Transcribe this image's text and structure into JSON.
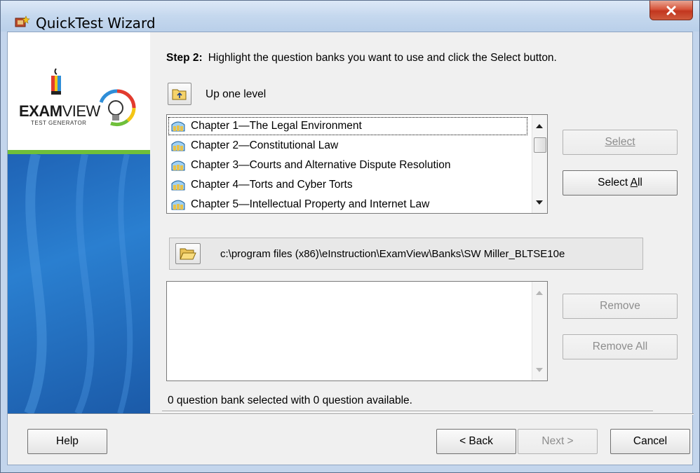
{
  "window": {
    "title": "QuickTest Wizard",
    "close_glyph": "✕"
  },
  "sidebar": {
    "logo_main": "EXAM",
    "logo_view": "VIEW",
    "logo_sub": "TEST GENERATOR"
  },
  "step": {
    "label": "Step 2:",
    "instruction": "Highlight the question banks you want to use and click the Select button."
  },
  "up_level": {
    "label": "Up one level"
  },
  "banks": {
    "items": [
      {
        "label": "Chapter 1—The Legal Environment",
        "selected": true
      },
      {
        "label": "Chapter 2—Constitutional Law",
        "selected": false
      },
      {
        "label": "Chapter 3—Courts and Alternative Dispute Resolution",
        "selected": false
      },
      {
        "label": "Chapter 4—Torts and Cyber Torts",
        "selected": false
      },
      {
        "label": "Chapter 5—Intellectual Property and Internet Law",
        "selected": false
      }
    ]
  },
  "buttons": {
    "select": "Select",
    "select_all_prefix": "Select ",
    "select_all_accel": "A",
    "select_all_suffix": "ll",
    "remove": "Remove",
    "remove_all": "Remove All",
    "help": "Help",
    "back": "< Back",
    "next": "Next >",
    "cancel": "Cancel"
  },
  "path": {
    "value": "c:\\program files (x86)\\eInstruction\\ExamView\\Banks\\SW Miller_BLTSE10e"
  },
  "status": {
    "text": "0 question bank selected with 0 question available."
  },
  "colors": {
    "titlebar": "#c5d8ee",
    "close_button": "#c2361f",
    "sidebar_blue": "#2a7fd0",
    "sidebar_green": "#6fbf3a",
    "client_bg": "#f0f0f0"
  },
  "icons": {
    "app": "examview-app-icon",
    "up_folder": "folder-up-icon",
    "folder": "folder-open-icon",
    "bank": "question-bank-icon"
  }
}
